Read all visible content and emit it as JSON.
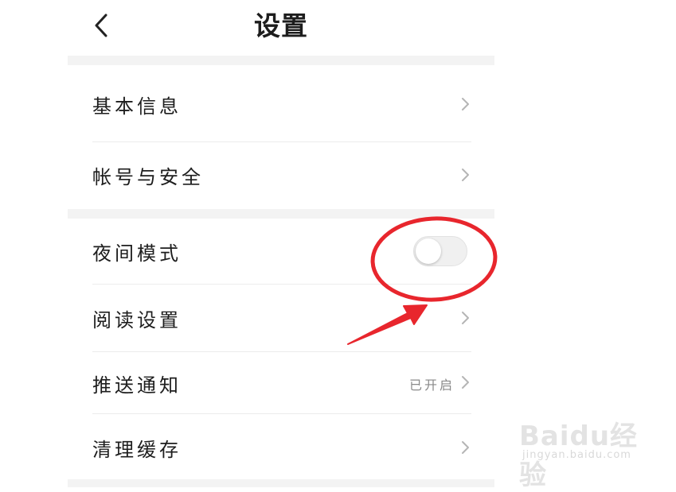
{
  "header": {
    "title": "设置",
    "back_icon": "chevron-left-icon"
  },
  "groups": [
    {
      "items": [
        {
          "label": "基本信息",
          "icon": "chevron-right-icon"
        },
        {
          "label": "帐号与安全",
          "icon": "chevron-right-icon"
        }
      ]
    },
    {
      "items": [
        {
          "label": "夜间模式",
          "toggle": {
            "on": false
          }
        },
        {
          "label": "阅读设置",
          "icon": "chevron-right-icon"
        },
        {
          "label": "推送通知",
          "value": "已开启",
          "icon": "chevron-right-icon"
        },
        {
          "label": "清理缓存",
          "icon": "chevron-right-icon"
        }
      ]
    }
  ],
  "annotation": {
    "shape": "ellipse-and-arrow",
    "color": "#e8262d"
  },
  "watermark": {
    "main": "Baidu经验",
    "sub": "jingyan.baidu.com"
  }
}
